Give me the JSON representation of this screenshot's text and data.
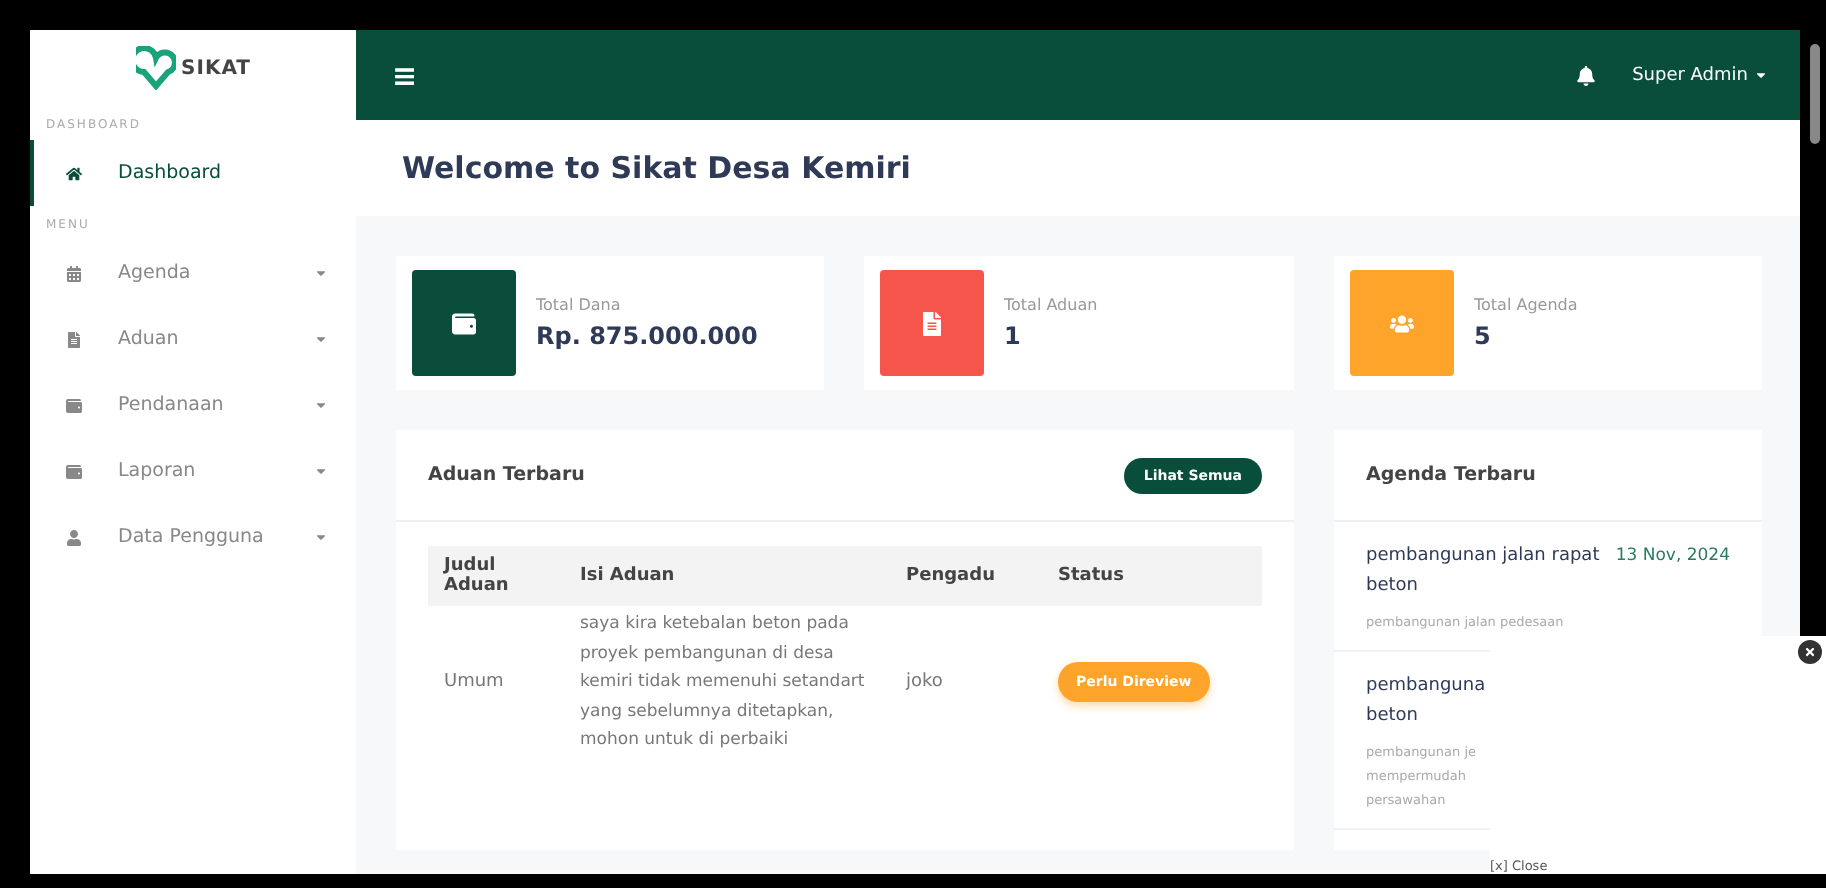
{
  "brand": {
    "name": "SIKAT"
  },
  "sidebar": {
    "sections": [
      {
        "heading": "DASHBOARD",
        "items": [
          {
            "label": "Dashboard",
            "selected": true,
            "has_caret": false
          }
        ]
      },
      {
        "heading": "MENU",
        "items": [
          {
            "label": "Agenda",
            "selected": false,
            "has_caret": true
          },
          {
            "label": "Aduan",
            "selected": false,
            "has_caret": true
          },
          {
            "label": "Pendanaan",
            "selected": false,
            "has_caret": true
          },
          {
            "label": "Laporan",
            "selected": false,
            "has_caret": true
          },
          {
            "label": "Data Pengguna",
            "selected": false,
            "has_caret": true
          }
        ]
      }
    ]
  },
  "topbar": {
    "menu_icon": "≡",
    "user": "Super Admin"
  },
  "page_title": "Welcome to Sikat Desa Kemiri",
  "stats": [
    {
      "label": "Total Dana",
      "value": "Rp. 875.000.000",
      "color": "#0a4d3a"
    },
    {
      "label": "Total Aduan",
      "value": "1",
      "color": "#f5554a"
    },
    {
      "label": "Total Agenda",
      "value": "5",
      "color": "#ffa42a"
    }
  ],
  "complaints": {
    "title": "Aduan Terbaru",
    "button": "Lihat Semua",
    "columns": [
      "Judul Aduan",
      "Isi Aduan",
      "Pengadu",
      "Status"
    ],
    "rows": [
      {
        "title": "Umum",
        "content": "saya kira ketebalan beton pada proyek pembangunan di desa kemiri tidak memenuhi setandart yang sebelumnya ditetapkan, mohon untuk di perbaiki",
        "reporter": "joko",
        "status": "Perlu Direview"
      }
    ]
  },
  "agenda": {
    "title": "Agenda Terbaru",
    "items": [
      {
        "name": "pembangunan jalan rapat beton",
        "date": "13 Nov, 2024",
        "description": "pembangunan jalan pedesaan"
      },
      {
        "name": "pembanguna beton",
        "description_lines": [
          "pembangunan je",
          "mempermudah",
          "persawahan"
        ]
      }
    ]
  },
  "overlay": {
    "close_link": "[x] Close"
  }
}
